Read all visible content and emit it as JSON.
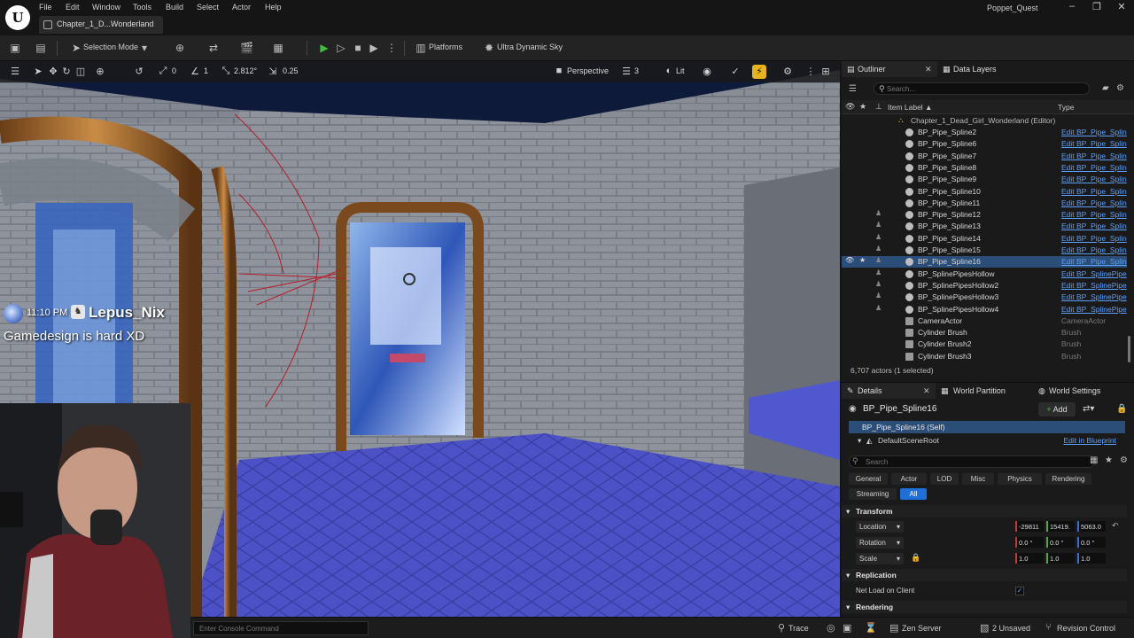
{
  "menu": {
    "items": [
      "File",
      "Edit",
      "Window",
      "Tools",
      "Build",
      "Select",
      "Actor",
      "Help"
    ],
    "level_tab": "Chapter_1_D...Wonderland",
    "project": "Poppet_Quest"
  },
  "toolbar": {
    "mode": "Selection Mode",
    "platforms": "Platforms",
    "sky": "Ultra Dynamic Sky"
  },
  "viewport": {
    "grid_snap": "0",
    "rotation_snap": "1",
    "scale_value": "2.812°",
    "camera_speed": "0.25",
    "view_mode": "Perspective",
    "layer_count": "3",
    "lighting": "Lit"
  },
  "stream_overlay": {
    "time": "11:10 PM",
    "username": "Lepus_Nix",
    "message": "Gamedesign is hard XD"
  },
  "outliner": {
    "tab_outliner": "Outliner",
    "tab_data_layers": "Data Layers",
    "search_placeholder": "Search...",
    "col_label": "Item Label ▲",
    "col_type": "Type",
    "root": "Chapter_1_Dead_Girl_Wonderland (Editor)",
    "rows": [
      {
        "name": "BP_Pipe_Spline2",
        "type": "Edit BP_Pipe_Splin",
        "pinned": false,
        "link": true
      },
      {
        "name": "BP_Pipe_Spline6",
        "type": "Edit BP_Pipe_Splin",
        "pinned": false,
        "link": true
      },
      {
        "name": "BP_Pipe_Spline7",
        "type": "Edit BP_Pipe_Splin",
        "pinned": false,
        "link": true
      },
      {
        "name": "BP_Pipe_Spline8",
        "type": "Edit BP_Pipe_Splin",
        "pinned": false,
        "link": true
      },
      {
        "name": "BP_Pipe_Spline9",
        "type": "Edit BP_Pipe_Splin",
        "pinned": false,
        "link": true
      },
      {
        "name": "BP_Pipe_Spline10",
        "type": "Edit BP_Pipe_Splin",
        "pinned": false,
        "link": true
      },
      {
        "name": "BP_Pipe_Spline11",
        "type": "Edit BP_Pipe_Splin",
        "pinned": false,
        "link": true
      },
      {
        "name": "BP_Pipe_Spline12",
        "type": "Edit BP_Pipe_Splin",
        "pinned": true,
        "link": true
      },
      {
        "name": "BP_Pipe_Spline13",
        "type": "Edit BP_Pipe_Splin",
        "pinned": true,
        "link": true
      },
      {
        "name": "BP_Pipe_Spline14",
        "type": "Edit BP_Pipe_Splin",
        "pinned": true,
        "link": true
      },
      {
        "name": "BP_Pipe_Spline15",
        "type": "Edit BP_Pipe_Splin",
        "pinned": true,
        "link": true
      },
      {
        "name": "BP_Pipe_Spline16",
        "type": "Edit BP_Pipe_Splin",
        "pinned": true,
        "link": true,
        "selected": true
      },
      {
        "name": "BP_SplinePipesHollow",
        "type": "Edit BP_SplinePipe",
        "pinned": true,
        "link": true
      },
      {
        "name": "BP_SplinePipesHollow2",
        "type": "Edit BP_SplinePipe",
        "pinned": true,
        "link": true
      },
      {
        "name": "BP_SplinePipesHollow3",
        "type": "Edit BP_SplinePipe",
        "pinned": true,
        "link": true
      },
      {
        "name": "BP_SplinePipesHollow4",
        "type": "Edit BP_SplinePipe",
        "pinned": true,
        "link": true
      },
      {
        "name": "CameraActor",
        "type": "CameraActor",
        "pinned": false,
        "link": false,
        "cam": true
      },
      {
        "name": "Cylinder Brush",
        "type": "Brush",
        "pinned": false,
        "link": false,
        "cam": true
      },
      {
        "name": "Cylinder Brush2",
        "type": "Brush",
        "pinned": false,
        "link": false,
        "cam": true
      },
      {
        "name": "Cylinder Brush3",
        "type": "Brush",
        "pinned": false,
        "link": false,
        "cam": true
      }
    ],
    "count": "6,707 actors (1 selected)"
  },
  "details": {
    "tab_details": "Details",
    "tab_world_partition": "World Partition",
    "tab_world_settings": "World Settings",
    "actor": "BP_Pipe_Spline16",
    "add_label": "Add",
    "self": "BP_Pipe_Spline16 (Self)",
    "root": "DefaultSceneRoot",
    "edit_blueprint": "Edit in Blueprint",
    "search_placeholder": "Search",
    "filters": [
      "General",
      "Actor",
      "LOD",
      "Misc",
      "Physics",
      "Rendering",
      "Streaming",
      "All"
    ],
    "transform_label": "Transform",
    "location_label": "Location",
    "rotation_label": "Rotation",
    "scale_label": "Scale",
    "location": [
      "-29811",
      "15419.",
      "5063.0"
    ],
    "rotation": [
      "0.0 °",
      "0.0 °",
      "0.0 °"
    ],
    "scale": [
      "1.0",
      "1.0",
      "1.0"
    ],
    "replication_label": "Replication",
    "net_load": "Net Load on Client",
    "rendering_label": "Rendering"
  },
  "statusbar": {
    "console_placeholder": "Enter Console Command",
    "trace": "Trace",
    "zen": "Zen Server",
    "unsaved": "2 Unsaved",
    "revision": "Revision Control"
  },
  "colors": {
    "accent": "#e8b41c",
    "selection": "#2a4e78",
    "link": "#5aa0ff",
    "play": "#3fbf3f"
  }
}
